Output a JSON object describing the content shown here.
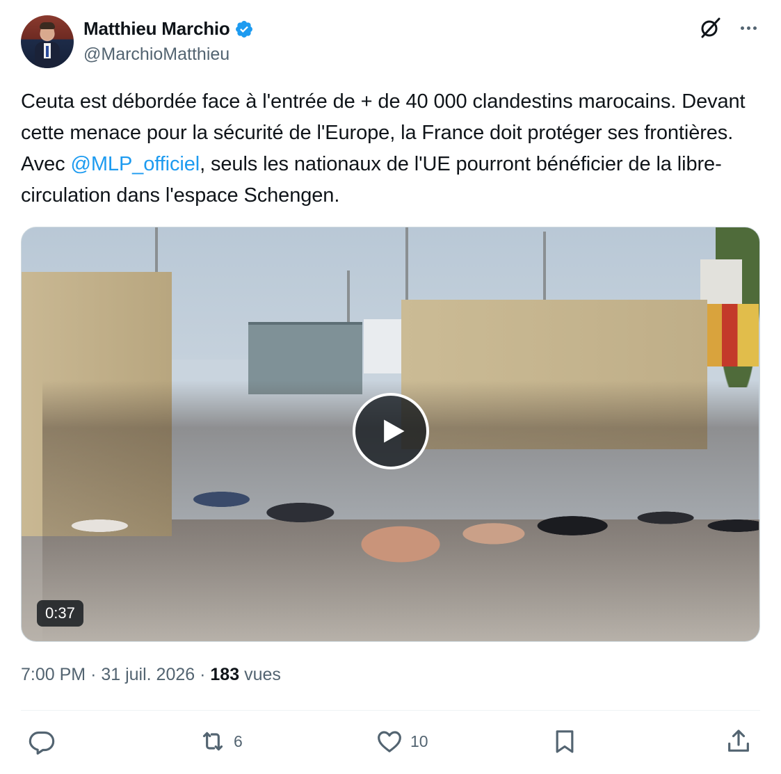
{
  "author": {
    "display_name": "Matthieu Marchio",
    "handle": "@MarchioMatthieu",
    "verified": true
  },
  "icons": {
    "verified": "verified-badge-icon",
    "grok": "grok-icon",
    "more": "more-icon",
    "play": "play-icon",
    "reply": "reply-icon",
    "retweet": "retweet-icon",
    "like": "heart-icon",
    "bookmark": "bookmark-icon",
    "share": "share-icon"
  },
  "tweet": {
    "text_before": "Ceuta est débordée face à l'entrée de + de 40 000 clandestins marocains. Devant cette menace pour la sécurité de l'Europe, la France doit protéger ses frontières. Avec ",
    "mention": "@MLP_officiel",
    "text_after": ", seuls les nationaux de l'UE pourront bénéficier de la libre-circulation dans l'espace Schengen."
  },
  "media": {
    "duration": "0:37"
  },
  "meta": {
    "time": "7:00 PM",
    "separator": "·",
    "date": "31 juil. 2026",
    "views_count": "183",
    "views_label": "vues"
  },
  "actions": {
    "retweets": "6",
    "likes": "10"
  },
  "colors": {
    "text": "#0f1419",
    "secondary": "#536471",
    "accent": "#1d9bf0",
    "divider": "#eff3f4"
  }
}
